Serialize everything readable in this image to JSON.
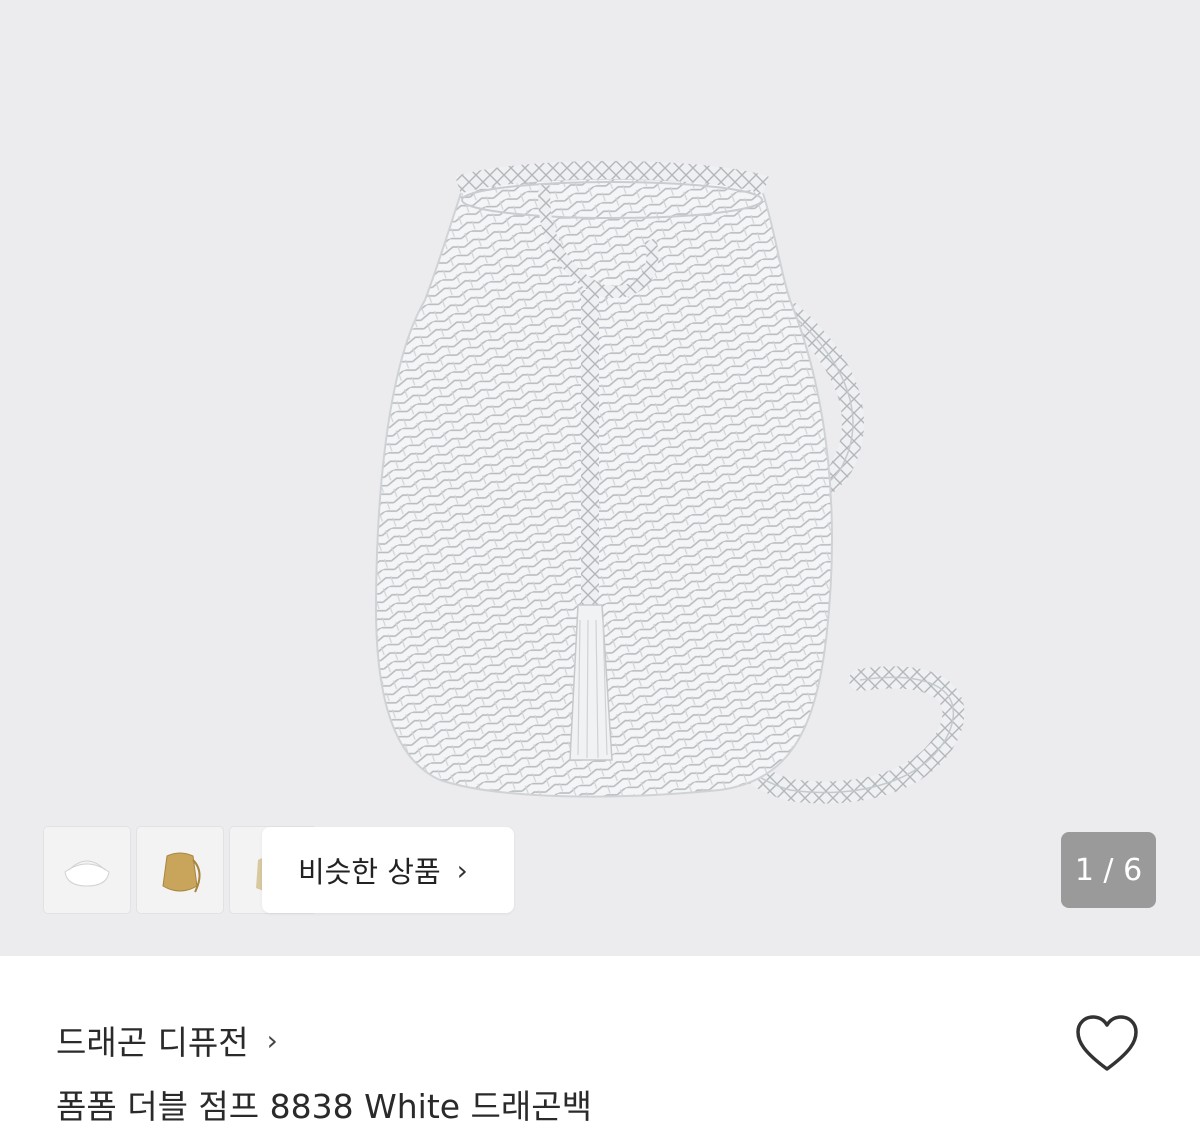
{
  "gallery": {
    "similar_label": "비슷한 상품",
    "counter": "1 / 6",
    "current_index": 1,
    "total": 6,
    "thumbnails": [
      {
        "name": "white-bag-thumbnail"
      },
      {
        "name": "gold-bag-thumbnail"
      },
      {
        "name": "third-bag-thumbnail"
      }
    ]
  },
  "product": {
    "brand": "드래곤 디퓨전",
    "title": "폼폼 더블 점프 8838 White 드래곤백"
  },
  "icons": {
    "brand_chevron": "chevron-right-icon",
    "similar_chevron": "chevron-right-icon",
    "like": "heart-icon"
  },
  "colors": {
    "hero_background": "#ececee",
    "counter_background": "#9a9a9b"
  }
}
